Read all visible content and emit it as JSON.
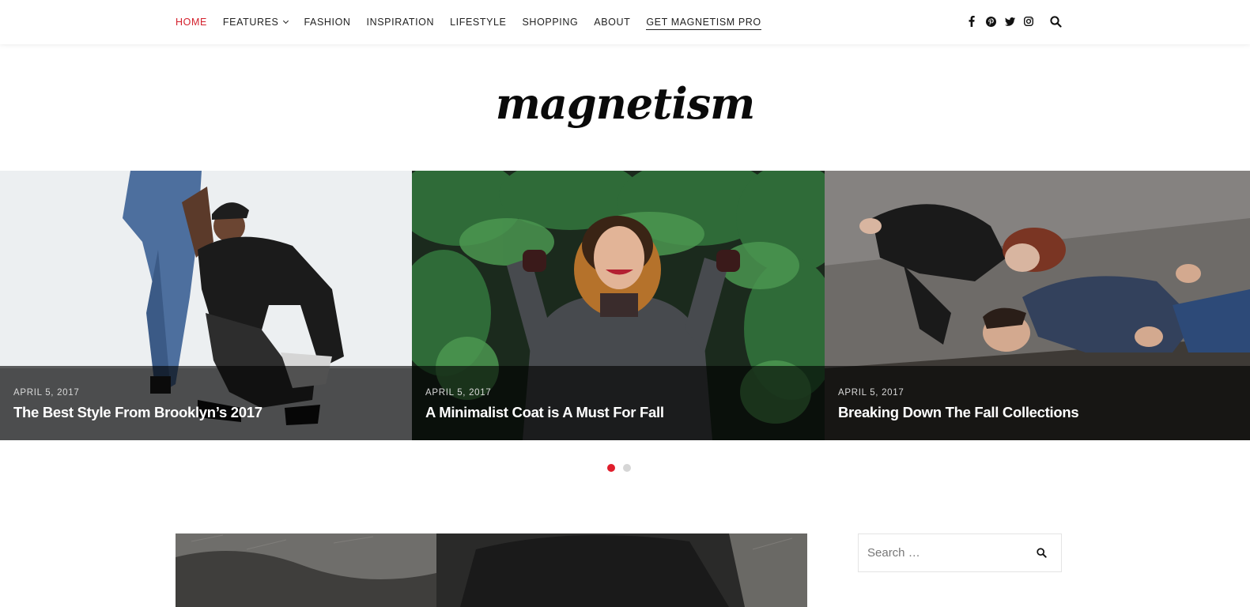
{
  "nav": {
    "items": [
      {
        "label": "HOME",
        "state": "active"
      },
      {
        "label": "FEATURES",
        "has_dropdown": true
      },
      {
        "label": "FASHION"
      },
      {
        "label": "INSPIRATION"
      },
      {
        "label": "LIFESTYLE"
      },
      {
        "label": "SHOPPING"
      },
      {
        "label": "ABOUT"
      },
      {
        "label": "GET MAGNETISM PRO",
        "underlined": true
      }
    ],
    "social_icons": [
      "facebook-icon",
      "pinterest-icon",
      "twitter-icon",
      "instagram-icon"
    ],
    "search_icon": "search-icon"
  },
  "brand": {
    "logo_text": "magnetism"
  },
  "slider": {
    "slides": [
      {
        "date": "APRIL 5, 2017",
        "title": "The Best Style From Brooklyn’s 2017"
      },
      {
        "date": "APRIL 5, 2017",
        "title": "A Minimalist Coat is A Must For Fall"
      },
      {
        "date": "APRIL 5, 2017",
        "title": "Breaking Down The Fall Collections"
      }
    ],
    "pagination": {
      "total": 2,
      "active": 1
    }
  },
  "sidebar": {
    "search": {
      "placeholder": "Search …"
    }
  },
  "colors": {
    "accent": "#e01e2c",
    "active_nav": "#d4202c",
    "text": "#222222"
  }
}
